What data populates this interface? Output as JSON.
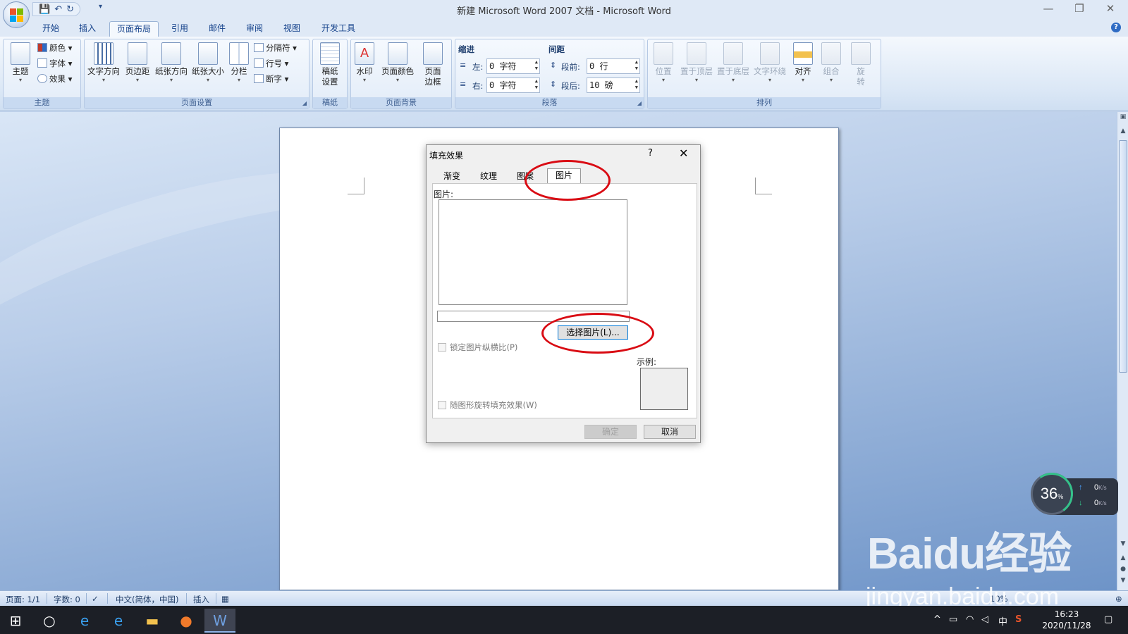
{
  "window": {
    "title": "新建 Microsoft Word 2007 文档 - Microsoft Word",
    "min_glyph": "—",
    "restore_glyph": "❐",
    "close_glyph": "✕",
    "qat_more": "▾"
  },
  "tabs": [
    "开始",
    "插入",
    "页面布局",
    "引用",
    "邮件",
    "审阅",
    "视图",
    "开发工具"
  ],
  "active_tab": "页面布局",
  "ribbon": {
    "theme": {
      "label": "主题",
      "big": "主题",
      "colors": "颜色",
      "fonts": "字体",
      "effects": "效果"
    },
    "page_setup": {
      "label": "页面设置",
      "text_direction": "文字方向",
      "margins": "页边距",
      "orientation": "纸张方向",
      "size": "纸张大小",
      "columns": "分栏",
      "breaks": "分隔符",
      "line_numbers": "行号",
      "hyphenation": "断字"
    },
    "draft_paper": {
      "label": "稿纸",
      "button_line1": "稿纸",
      "button_line2": "设置"
    },
    "page_background": {
      "label": "页面背景",
      "watermark": "水印",
      "page_color": "页面颜色",
      "borders_line1": "页面",
      "borders_line2": "边框"
    },
    "paragraph": {
      "label": "段落",
      "indent_title": "缩进",
      "spacing_title": "间距",
      "indent_left_label": "左:",
      "indent_left_value": "0 字符",
      "indent_right_label": "右:",
      "indent_right_value": "0 字符",
      "space_before_label": "段前:",
      "space_before_value": "0 行",
      "space_after_label": "段后:",
      "space_after_value": "10 磅"
    },
    "arrange": {
      "label": "排列",
      "position": "位置",
      "bring_front": "置于顶层",
      "send_back": "置于底层",
      "text_wrap": "文字环绕",
      "align": "对齐",
      "group": "组合",
      "rotate_line1": "旋",
      "rotate_line2": "转"
    }
  },
  "dialog": {
    "title": "填充效果",
    "help": "?",
    "close": "✕",
    "tabs": [
      "渐变",
      "纹理",
      "图案",
      "图片"
    ],
    "active_tab": "图片",
    "picture_label": "图片:",
    "choose_button": "选择图片(L)...",
    "lock_aspect": "锁定图片纵横比(P)",
    "rotate_with_shape": "随图形旋转填充效果(W)",
    "sample_label": "示例:",
    "ok": "确定",
    "cancel": "取消"
  },
  "statusbar": {
    "page": "页面: 1/1",
    "words": "字数: 0",
    "language": "中文(简体，中国)",
    "insert_mode": "插入",
    "zoom": "10%"
  },
  "net_widget": {
    "percent": "36",
    "percent_sign": "%",
    "up_speed": "0",
    "down_speed": "0",
    "unit": "K/s"
  },
  "watermark": {
    "brand": "Baidu经验",
    "url": "jingyan.baidu.com"
  },
  "taskbar": {
    "time": "16:23",
    "date": "2020/11/28",
    "ime": "中"
  },
  "colors": {
    "annotation_red": "#d90b13",
    "ribbon_text_blue": "#15428b",
    "focus_blue": "#0078d7"
  }
}
